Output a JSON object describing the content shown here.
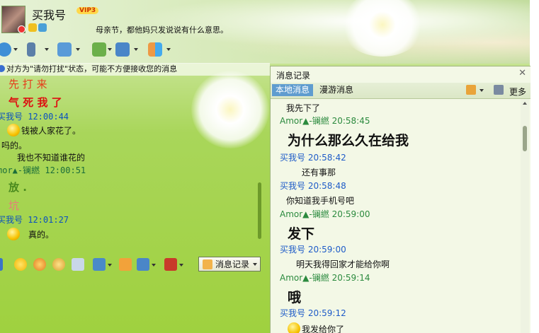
{
  "header": {
    "nickname": "买我号",
    "vip_badge": "VIP3",
    "signature": "母亲节，都他妈只发说说有什么意思。"
  },
  "notice": "对方为\"请勿打扰\"状态，可能不方便接收您的消息",
  "chat": {
    "lines": [
      {
        "text": "先 打 来"
      },
      {
        "text": "气 死 我 了"
      },
      {
        "header": "买我号  12:00:44"
      },
      {
        "text": "钱被人家花了。"
      },
      {
        "text": "吗的。"
      },
      {
        "text": "我也不知道谁花的"
      },
      {
        "header": "mor▲-镧繎  12:00:51"
      },
      {
        "text": "放 ."
      },
      {
        "text": "坑"
      },
      {
        "header": "买我号  12:01:27"
      },
      {
        "text": "真的。"
      }
    ]
  },
  "bottom": {
    "history_button": "消息记录"
  },
  "history": {
    "title": "消息记录",
    "tabs": [
      "本地消息",
      "漫游消息"
    ],
    "more": "更多",
    "entries": [
      {
        "text": "我先下了"
      },
      {
        "who": "Amor▲-镧繎",
        "time": "20:58:45"
      },
      {
        "text": "为什么那么久在给我"
      },
      {
        "who": "买我号",
        "time": "20:58:42"
      },
      {
        "text": "还有事那"
      },
      {
        "who": "买我号",
        "time": "20:58:48"
      },
      {
        "text": "你知道我手机号吧"
      },
      {
        "who": "Amor▲-镧繎",
        "time": "20:59:00"
      },
      {
        "text": "发下"
      },
      {
        "who": "买我号",
        "time": "20:59:00"
      },
      {
        "text": "明天我得回家才能给你啊"
      },
      {
        "who": "Amor▲-镧繎",
        "time": "20:59:14"
      },
      {
        "text": "哦"
      },
      {
        "who": "买我号",
        "time": "20:59:12"
      },
      {
        "text": "我发给你了"
      }
    ]
  },
  "colors": {
    "chat_bg": "#a9d65a",
    "history_bg": "#f3f8e6",
    "active_tab": "#5f9ccf"
  }
}
